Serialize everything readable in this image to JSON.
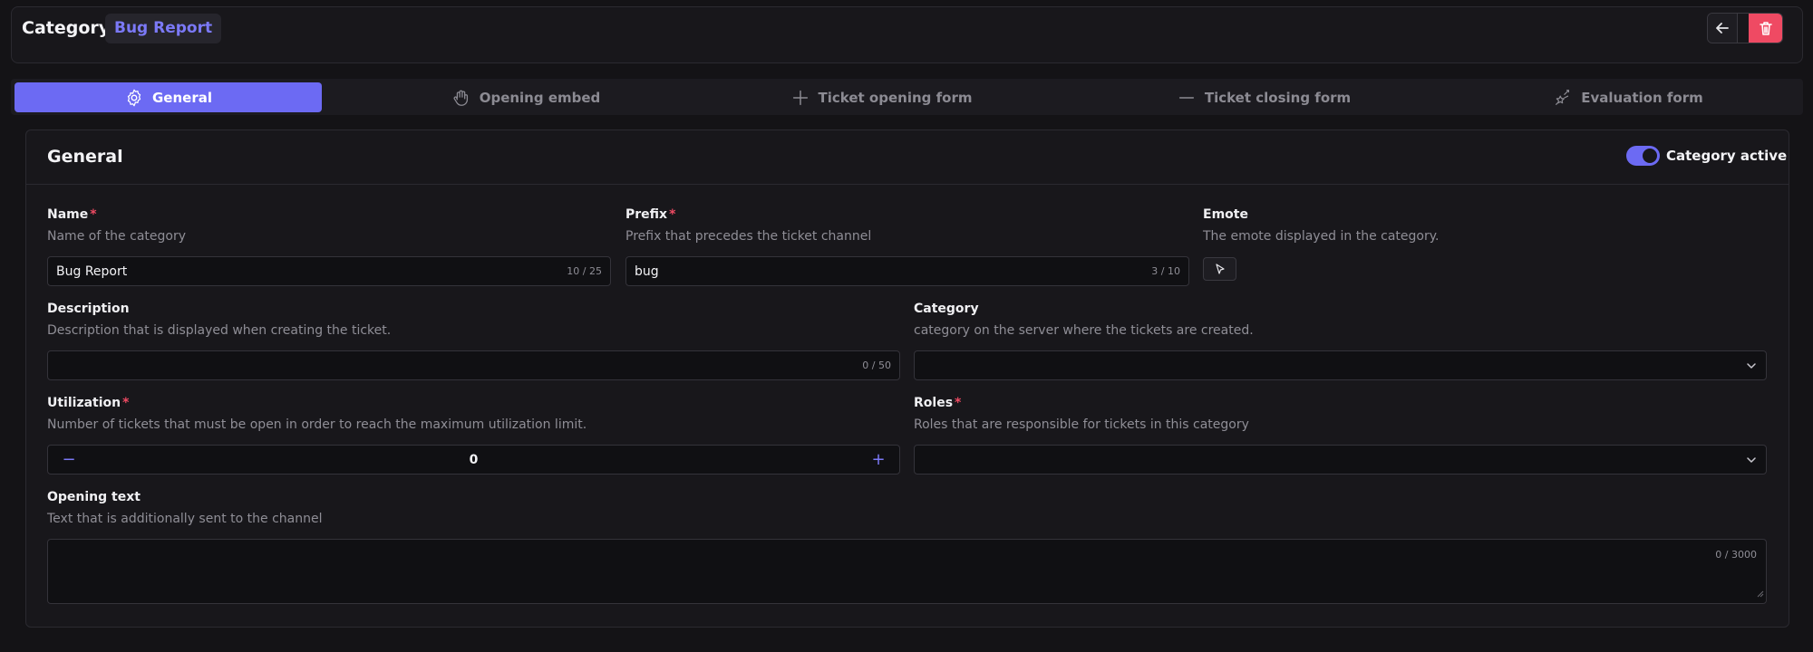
{
  "header": {
    "title": "Category",
    "badge": "Bug Report"
  },
  "tabs": [
    {
      "label": "General",
      "icon": "gear-icon",
      "active": true
    },
    {
      "label": "Opening embed",
      "icon": "hand-wave-icon",
      "active": false
    },
    {
      "label": "Ticket opening form",
      "icon": "plus-icon",
      "active": false
    },
    {
      "label": "Ticket closing form",
      "icon": "minus-icon",
      "active": false
    },
    {
      "label": "Evaluation form",
      "icon": "stars-icon",
      "active": false
    }
  ],
  "panel": {
    "title": "General",
    "toggle_label": "Category active",
    "toggle_on": true
  },
  "fields": {
    "name": {
      "label": "Name",
      "required_mark": "*",
      "desc": "Name of the category",
      "value": "Bug Report",
      "counter": "10 / 25"
    },
    "prefix": {
      "label": "Prefix",
      "required_mark": "*",
      "desc": "Prefix that precedes the ticket channel",
      "value": "bug",
      "counter": "3 / 10"
    },
    "emote": {
      "label": "Emote",
      "desc": "The emote displayed in the category."
    },
    "description": {
      "label": "Description",
      "desc": "Description that is displayed when creating the ticket.",
      "value": "",
      "counter": "0 / 50"
    },
    "category": {
      "label": "Category",
      "desc": "category on the server where the tickets are created.",
      "value": ""
    },
    "utilization": {
      "label": "Utilization",
      "required_mark": "*",
      "desc": "Number of tickets that must be open in order to reach the maximum utilization limit.",
      "value": "0",
      "minus": "−",
      "plus": "+"
    },
    "roles": {
      "label": "Roles",
      "required_mark": "*",
      "desc": "Roles that are responsible for tickets in this category",
      "value": ""
    },
    "opening_text": {
      "label": "Opening text",
      "desc": "Text that is additionally sent to the channel",
      "value": "",
      "counter": "0 / 3000"
    }
  },
  "colors": {
    "accent": "#6c6af3",
    "danger": "#ef4a63",
    "background": "#141316",
    "panel": "#18171b"
  }
}
